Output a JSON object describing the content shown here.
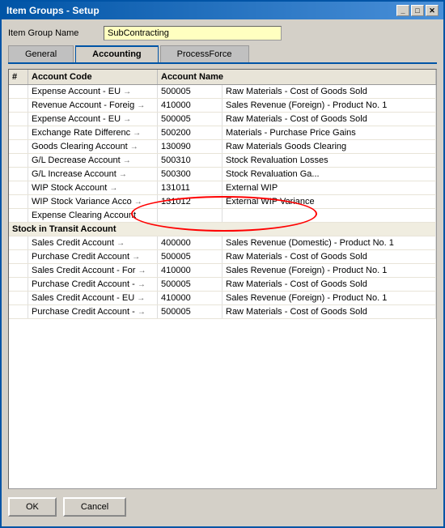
{
  "window": {
    "title": "Item Groups - Setup",
    "title_buttons": [
      "_",
      "□",
      "✕"
    ]
  },
  "form": {
    "field_label": "Item Group Name",
    "field_value": "SubContracting"
  },
  "tabs": [
    {
      "label": "General",
      "active": false
    },
    {
      "label": "Accounting",
      "active": true
    },
    {
      "label": "ProcessForce",
      "active": false
    }
  ],
  "table": {
    "columns": [
      {
        "label": "#"
      },
      {
        "label": "Account Code"
      },
      {
        "label": "Account Name"
      }
    ],
    "rows": [
      {
        "type": "data",
        "name": "Expense Account - EU",
        "arrow": "→",
        "code": "500005",
        "account_name": "Raw Materials - Cost of Goods Sold"
      },
      {
        "type": "data",
        "name": "Revenue Account - Foreig",
        "arrow": "→",
        "code": "410000",
        "account_name": "Sales Revenue (Foreign) - Product No. 1"
      },
      {
        "type": "data",
        "name": "Expense Account - EU",
        "arrow": "→",
        "code": "500005",
        "account_name": "Raw Materials - Cost of Goods Sold"
      },
      {
        "type": "data",
        "name": "Exchange Rate Differenc",
        "arrow": "→",
        "code": "500200",
        "account_name": "Materials - Purchase Price Gains"
      },
      {
        "type": "data",
        "name": "Goods Clearing Account",
        "arrow": "→",
        "code": "130090",
        "account_name": "Raw Materials Goods Clearing"
      },
      {
        "type": "data",
        "name": "G/L Decrease Account",
        "arrow": "→",
        "code": "500310",
        "account_name": "Stock Revaluation Losses"
      },
      {
        "type": "data",
        "name": "G/L Increase Account",
        "arrow": "→",
        "code": "500300",
        "account_name": "Stock Revaluation Ga..."
      },
      {
        "type": "data",
        "name": "WIP Stock Account",
        "arrow": "→",
        "code": "131011",
        "account_name": "External WIP",
        "highlight": true
      },
      {
        "type": "data",
        "name": "WIP Stock Variance Acco",
        "arrow": "→",
        "code": "131012",
        "account_name": "External WIP Variance",
        "highlight": true
      },
      {
        "type": "data",
        "name": "Expense Clearing Account",
        "arrow": "",
        "code": "",
        "account_name": ""
      },
      {
        "type": "section",
        "name": "Stock in Transit Account"
      },
      {
        "type": "data",
        "name": "Sales Credit Account",
        "arrow": "→",
        "code": "400000",
        "account_name": "Sales Revenue (Domestic) - Product No. 1"
      },
      {
        "type": "data",
        "name": "Purchase Credit Account",
        "arrow": "→",
        "code": "500005",
        "account_name": "Raw Materials - Cost of Goods Sold"
      },
      {
        "type": "data",
        "name": "Sales Credit Account - For",
        "arrow": "→",
        "code": "410000",
        "account_name": "Sales Revenue (Foreign) - Product No. 1"
      },
      {
        "type": "data",
        "name": "Purchase Credit Account -",
        "arrow": "→",
        "code": "500005",
        "account_name": "Raw Materials - Cost of Goods Sold"
      },
      {
        "type": "data",
        "name": "Sales Credit Account - EU",
        "arrow": "→",
        "code": "410000",
        "account_name": "Sales Revenue (Foreign) - Product No. 1"
      },
      {
        "type": "data",
        "name": "Purchase Credit Account -",
        "arrow": "→",
        "code": "500005",
        "account_name": "Raw Materials - Cost of Goods Sold"
      }
    ]
  },
  "buttons": {
    "ok_label": "OK",
    "cancel_label": "Cancel"
  }
}
